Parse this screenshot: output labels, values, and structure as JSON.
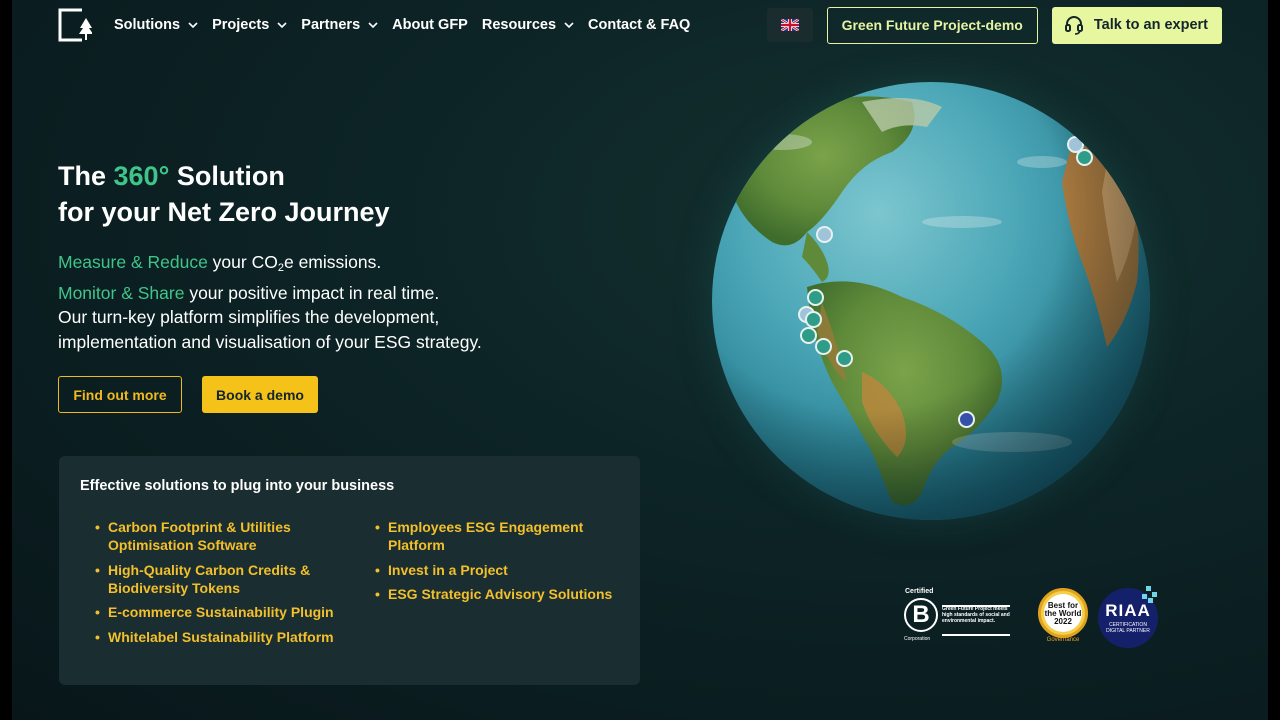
{
  "nav": {
    "items": [
      {
        "label": "Solutions",
        "dropdown": true
      },
      {
        "label": "Projects",
        "dropdown": true
      },
      {
        "label": "Partners",
        "dropdown": true
      },
      {
        "label": "About GFP",
        "dropdown": false
      },
      {
        "label": "Resources",
        "dropdown": true
      },
      {
        "label": "Contact & FAQ",
        "dropdown": false
      }
    ],
    "language_flag": "uk-flag-icon",
    "demo_button": "Green Future Project-demo",
    "expert_button": "Talk to an expert"
  },
  "hero": {
    "title_pre": "The ",
    "title_accent": "360°",
    "title_post": " Solution",
    "title_line2": "for your Net Zero Journey",
    "line1_accent": "Measure & Reduce",
    "line1_rest_a": " your CO",
    "line1_sub": "2",
    "line1_rest_b": "e emissions.",
    "line2_accent": "Monitor & Share",
    "line2_rest": " your positive impact in real time.",
    "line3": "Our turn-key platform simplifies the development,",
    "line4": "implementation and visualisation of your ESG strategy.",
    "btn_find": "Find out more",
    "btn_book": "Book a demo"
  },
  "solutions": {
    "title": "Effective solutions to plug into your business",
    "col1": [
      "Carbon Footprint & Utilities Optimisation Software",
      "High-Quality Carbon Credits & Biodiversity Tokens",
      "E-commerce Sustainability Plugin",
      "Whitelabel Sustainability Platform"
    ],
    "col2": [
      "Employees ESG Engagement Platform",
      "Invest in a Project",
      "ESG Strategic Advisory Solutions"
    ]
  },
  "certs": {
    "bcorp_certified": "Certified",
    "bcorp_letter": "B",
    "bcorp_corporation": "Corporation",
    "bcorp_desc": "Green Future Project meets high standards of social and environmental impact.",
    "bfw_text": "Best for the World",
    "bfw_year": "2022",
    "bfw_label": "Governance",
    "riaa_title": "RIAA",
    "riaa_sub": "CERTIFICATION DIGITAL PARTNER"
  },
  "colors": {
    "accent_green": "#3fc58a",
    "gold": "#f0b91e",
    "lime": "#e6f7a0",
    "background": "#0d2426"
  }
}
